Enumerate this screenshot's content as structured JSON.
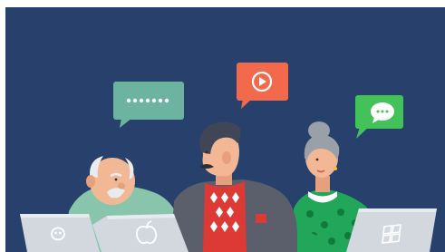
{
  "image": {
    "description_less": true,
    "colors": {
      "panel_background": "#27416c",
      "frame_background": "#ffffff",
      "chat_bubble_teal": "#6db4a0",
      "play_bubble_orange": "#f26a4b",
      "message_bubble_green": "#43c25a",
      "laptop_silver": "#d3d8df",
      "grandpa_sweater": "#89c5ad",
      "grandma_dress": "#22a65a",
      "man_jacket": "#5b5e6b",
      "man_sweater": "#dd3a36",
      "man_hair": "#414657",
      "grandma_hair": "#9aa0a8",
      "skin": "#f2b794",
      "skin_shade": "#e6a07e"
    },
    "icons": {
      "chat_bubble": "chat-dots-bubble-icon",
      "play_bubble": "play-button-bubble-icon",
      "message_bubble": "messaging-app-bubble-icon",
      "laptop_left_logo": "skull-logo-icon",
      "laptop_middle_logo": "apple-logo-icon",
      "laptop_right_logo": "windows-logo-icon"
    }
  }
}
